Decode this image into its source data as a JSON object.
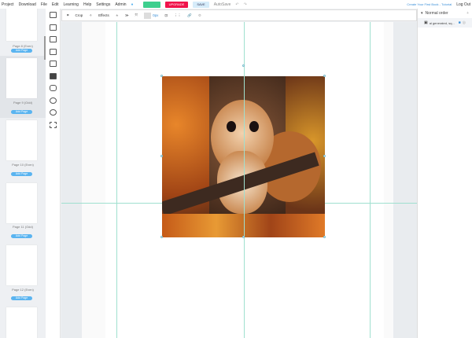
{
  "menu": {
    "items": [
      "Project",
      "Download",
      "File",
      "Edit",
      "Learning",
      "Help",
      "Settings",
      "Admin"
    ],
    "upload": "",
    "upgrade": "UPGRADE",
    "save": "SAVE",
    "autosave": "AutoSave",
    "tutorial": "Create Your First Book - Tutorial",
    "logout": "Log Out"
  },
  "colors": {
    "upload": "#3ecf8e",
    "upgrade": "#f0144b",
    "save": "#d6ecfa",
    "accent": "#5ab4f0"
  },
  "pages": [
    {
      "label": "Page 8 (Even)",
      "add": "Add Page"
    },
    {
      "label": "Page 9 (Odd)",
      "add": "Add Page"
    },
    {
      "label": "Page 10 (Even)",
      "add": "Add Page"
    },
    {
      "label": "Page 11 (Odd)",
      "add": "Add Page"
    },
    {
      "label": "Page 12 (Even)",
      "add": "Add Page"
    }
  ],
  "toolbar": {
    "crop": "Crop",
    "effects": "Effects",
    "opacity": "0px"
  },
  "layers": {
    "header": "Normal order",
    "items": [
      {
        "name": "ai generated, sq..."
      }
    ]
  }
}
